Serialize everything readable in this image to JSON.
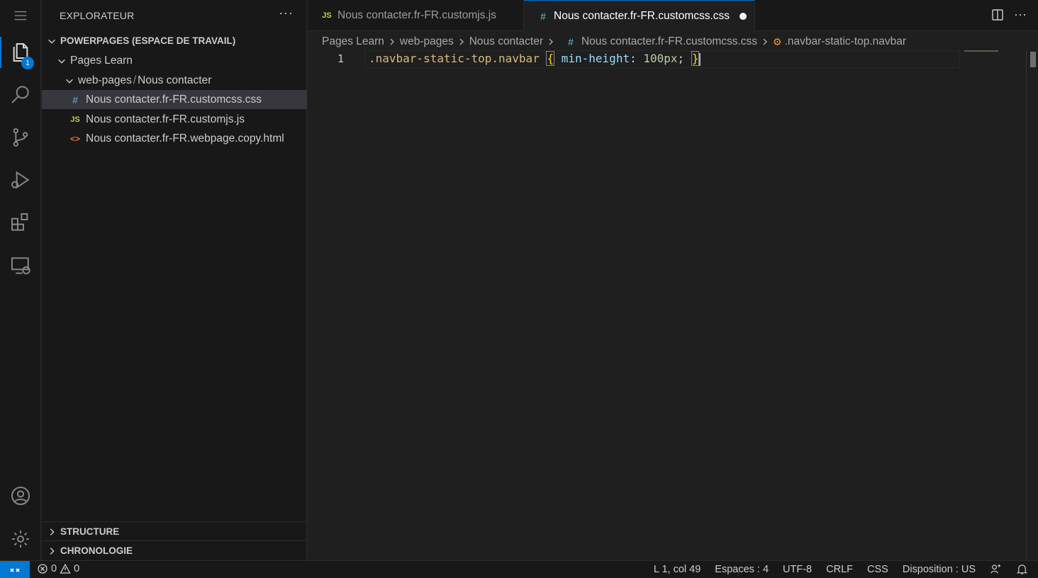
{
  "sidebar": {
    "title": "EXPLORATEUR",
    "more": "···",
    "workspace": "POWERPAGES (ESPACE DE TRAVAIL)",
    "folder1": "Pages Learn",
    "folder2a": "web-pages",
    "folder2sep": "/",
    "folder2b": "Nous contacter",
    "files": [
      {
        "name": "Nous contacter.fr-FR.customcss.css",
        "icon": "#",
        "type": "css"
      },
      {
        "name": "Nous contacter.fr-FR.customjs.js",
        "icon": "JS",
        "type": "js"
      },
      {
        "name": "Nous contacter.fr-FR.webpage.copy.html",
        "icon": "<>",
        "type": "html"
      }
    ],
    "panels": [
      "STRUCTURE",
      "CHRONOLOGIE"
    ]
  },
  "activity": {
    "explorer_badge": "1",
    "items": [
      "files-icon",
      "search-icon",
      "source-control-icon",
      "run-debug-icon",
      "extensions-icon",
      "remote-explorer-icon",
      "account-icon",
      "settings-gear-icon"
    ]
  },
  "tabs": [
    {
      "label": "Nous contacter.fr-FR.customjs.js",
      "icon": "JS"
    },
    {
      "label": "Nous contacter.fr-FR.customcss.css",
      "icon": "#"
    }
  ],
  "breadcrumb": {
    "p1": "Pages Learn",
    "p2": "web-pages",
    "p3": "Nous contacter",
    "p4_icon": "#",
    "p4": "Nous contacter.fr-FR.customcss.css",
    "p5": ".navbar-static-top.navbar"
  },
  "editor": {
    "line_number": "1",
    "selector": ".navbar-static-top.navbar",
    "open_brace": "{",
    "property": "min-height",
    "colon": ":",
    "value": "100px",
    "semicolon": ";",
    "close_brace": "}"
  },
  "status": {
    "errors": "0",
    "warnings": "0",
    "position": "L 1, col 49",
    "spaces": "Espaces : 4",
    "encoding": "UTF-8",
    "eol": "CRLF",
    "language": "CSS",
    "layout": "Disposition : US"
  },
  "colors": {
    "accent": "#0078d4",
    "background": "#1f1f1f",
    "sidebar": "#181818"
  }
}
